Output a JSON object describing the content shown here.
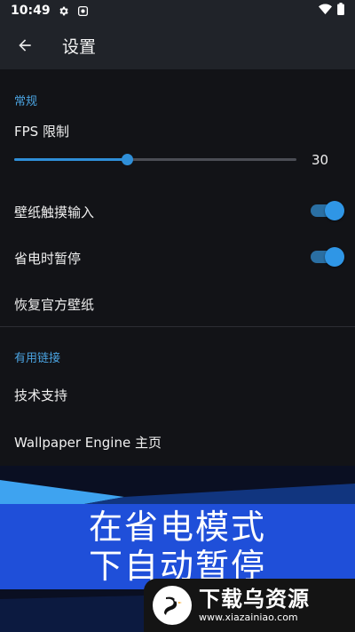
{
  "status_bar": {
    "time": "10:49",
    "left_icons": [
      "gear-icon",
      "screen-record-icon"
    ],
    "right_icons": [
      "wifi-icon",
      "battery-icon"
    ]
  },
  "app_bar": {
    "title": "设置",
    "back_icon": "arrow-left-icon"
  },
  "sections": {
    "general": {
      "header": "常规",
      "fps": {
        "label": "FPS 限制",
        "value": "30",
        "slider_fraction": 0.4
      },
      "touch_input": {
        "label": "壁纸触摸输入",
        "enabled": true
      },
      "power_save_pause": {
        "label": "省电时暂停",
        "enabled": true
      },
      "restore": {
        "label": "恢复官方壁纸"
      }
    },
    "links": {
      "header": "有用链接",
      "support": {
        "label": "技术支持"
      },
      "homepage": {
        "label": "Wallpaper Engine 主页"
      }
    }
  },
  "banner": {
    "line1": "在省电模式",
    "line2": "下自动暂停"
  },
  "watermark": {
    "name": "下载乌资源",
    "url": "www.xiazainiao.com"
  },
  "colors": {
    "accent": "#2f8fd8",
    "section_header": "#4aa3e0",
    "banner": "#1f4fd9",
    "list_bg": "#121317",
    "appbar_bg": "#202329"
  }
}
